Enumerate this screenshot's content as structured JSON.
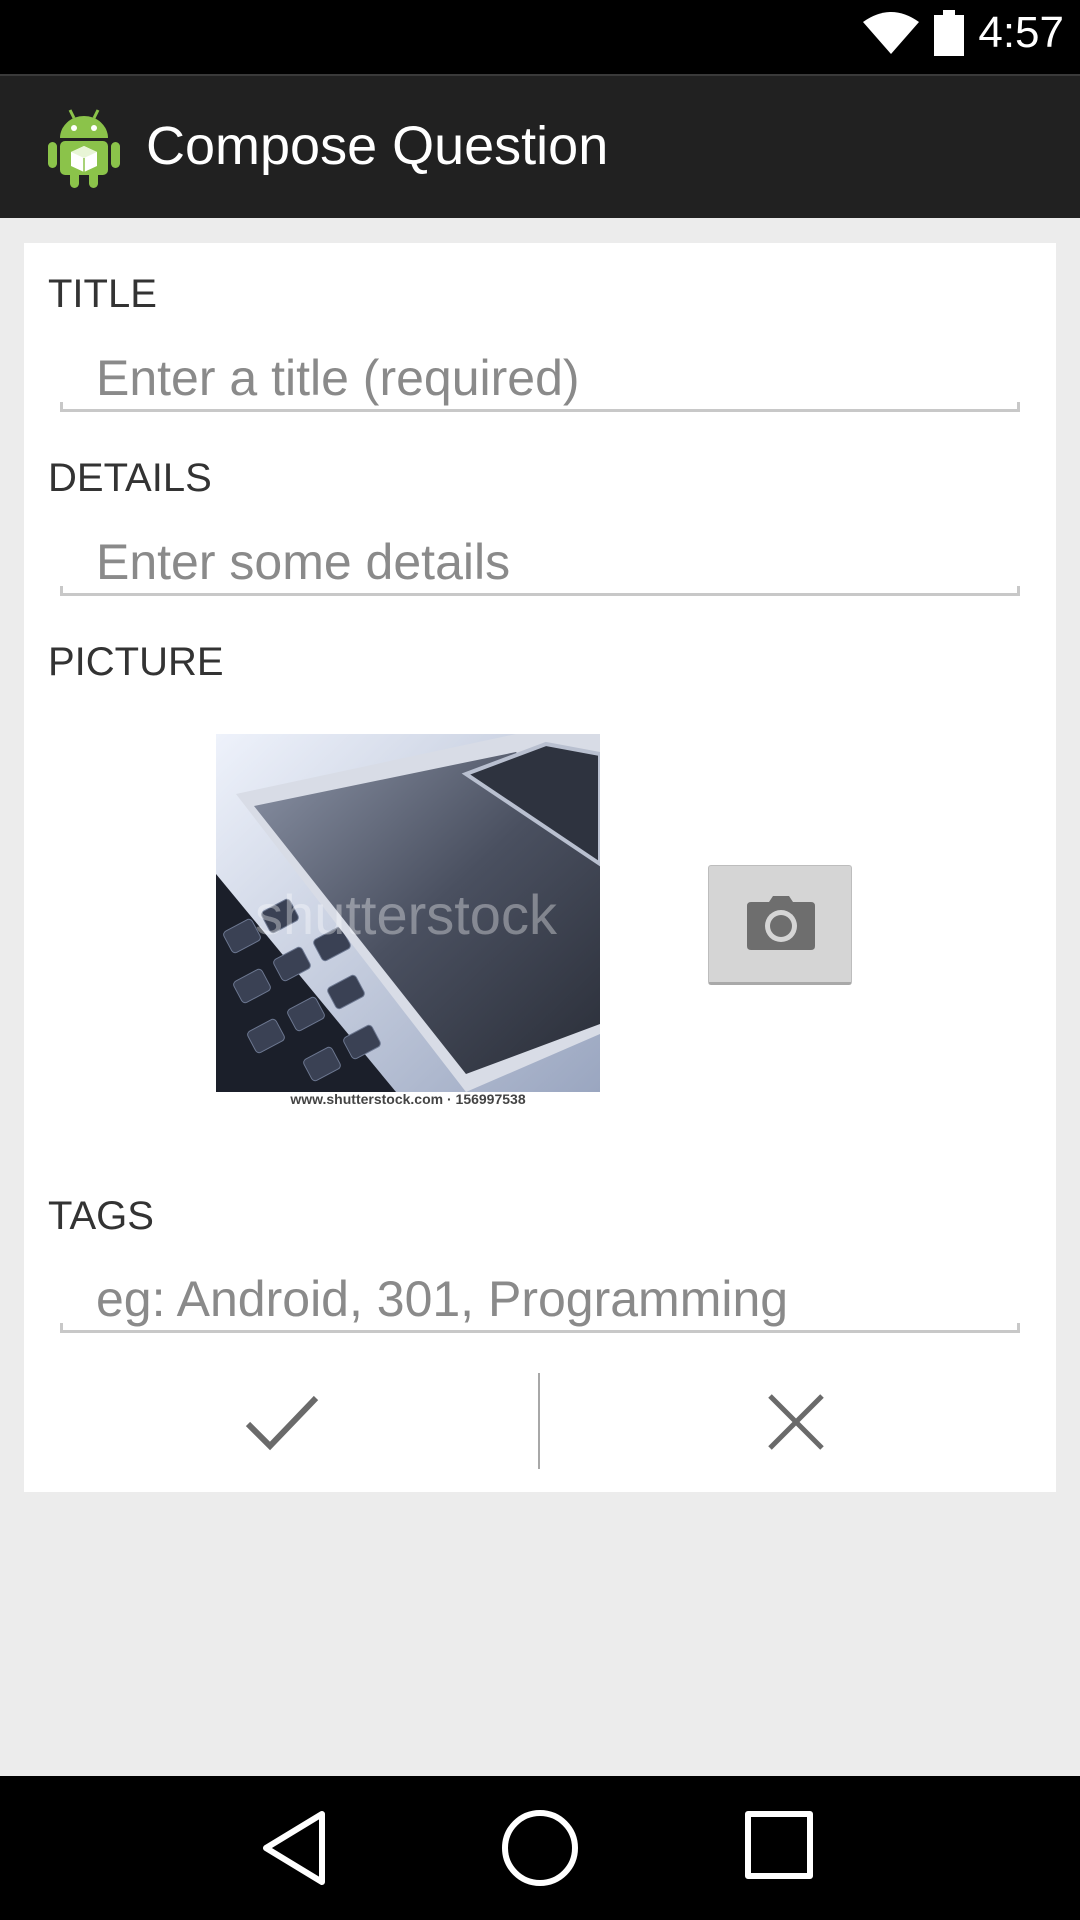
{
  "status_bar": {
    "time": "4:57",
    "icons": [
      "wifi-icon",
      "battery-icon"
    ]
  },
  "action_bar": {
    "title": "Compose Question",
    "icon": "android-app-icon"
  },
  "form": {
    "title_label": "TITLE",
    "title_value": "",
    "title_placeholder": "Enter a title (required)",
    "details_label": "DETAILS",
    "details_value": "",
    "details_placeholder": "Enter some details",
    "picture_label": "PICTURE",
    "picture_watermark": "shutterstock",
    "picture_caption": "www.shutterstock.com · 156997538",
    "camera_icon": "camera-icon",
    "tags_label": "TAGS",
    "tags_value": "",
    "tags_placeholder": "eg: Android, 301, Programming"
  },
  "actions": {
    "accept_icon": "check-icon",
    "cancel_icon": "close-icon"
  },
  "nav_bar": {
    "icons": [
      "back-icon",
      "home-icon",
      "recents-icon"
    ]
  },
  "colors": {
    "status_bar": "#000000",
    "action_bar": "#212121",
    "background": "#ececec",
    "card": "#ffffff",
    "underline": "#c8c8c8",
    "android_green": "#8bc34a"
  }
}
